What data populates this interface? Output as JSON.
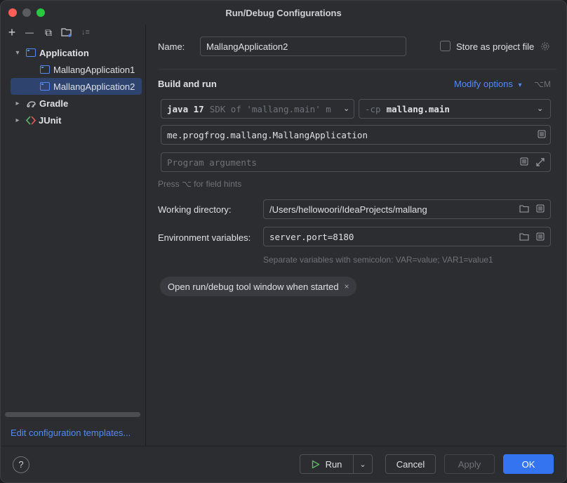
{
  "window": {
    "title": "Run/Debug Configurations"
  },
  "toolbar": {
    "add": "+",
    "remove": "—",
    "copy": "⧉",
    "folder": "▣",
    "sort": "↓≡"
  },
  "tree": {
    "application": "Application",
    "items": [
      "MallangApplication1",
      "MallangApplication2"
    ],
    "gradle": "Gradle",
    "junit": "JUnit"
  },
  "edit_templates": "Edit configuration templates...",
  "form": {
    "name_label": "Name:",
    "name_value": "MallangApplication2",
    "store_label": "Store as project file",
    "build_run": "Build and run",
    "modify_options": "Modify options",
    "modify_shortcut": "⌥M",
    "sdk_java": "java 17",
    "sdk_rest": "SDK of 'mallang.main' m",
    "cp_flag": "-cp",
    "cp_value": "mallang.main",
    "main_class": "me.progfrog.mallang.MallangApplication",
    "program_args_placeholder": "Program arguments",
    "press_hint": "Press ⌥ for field hints",
    "working_dir_label": "Working directory:",
    "working_dir_value": "/Users/hellowoori/IdeaProjects/mallang",
    "env_label": "Environment variables:",
    "env_value": "server.port=8180",
    "env_hint": "Separate variables with semicolon: VAR=value; VAR1=value1",
    "tag_label": "Open run/debug tool window when started",
    "tag_close": "×"
  },
  "buttons": {
    "help": "?",
    "run": "Run",
    "cancel": "Cancel",
    "apply": "Apply",
    "ok": "OK"
  },
  "colors": {
    "accent": "#3574f0",
    "link": "#548af7",
    "selection": "#2e436e",
    "run_green": "#5fb865"
  }
}
